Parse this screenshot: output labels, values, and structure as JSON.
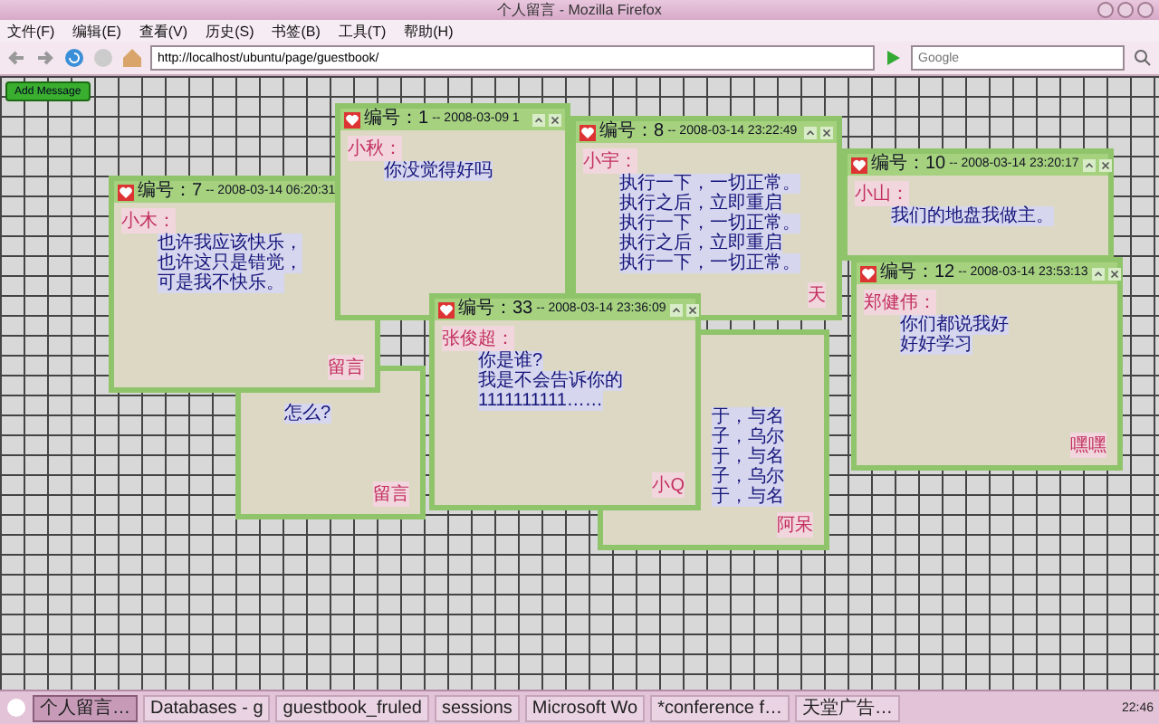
{
  "window": {
    "title": "个人留言 - Mozilla Firefox"
  },
  "menu": [
    "文件(F)",
    "编辑(E)",
    "查看(V)",
    "历史(S)",
    "书签(B)",
    "工具(T)",
    "帮助(H)"
  ],
  "address": {
    "value": "http://localhost/ubuntu/page/guestbook/"
  },
  "search": {
    "placeholder": "Google"
  },
  "add_button": "Add Message",
  "notes": [
    {
      "body": [
        "怎么?"
      ],
      "signature": "留言"
    },
    {
      "body": [
        "于，与名",
        "子，乌尔",
        "于，与名",
        "子，乌尔",
        "于，与名"
      ],
      "signature": "阿呆"
    },
    {
      "number": "编号：7",
      "date": "-- 2008-03-14 06:20:31",
      "name": "小木：",
      "body": [
        "也许我应该快乐，",
        "也许这只是错觉，",
        "可是我不快乐。"
      ],
      "signature": "留言"
    },
    {
      "number": "编号：1",
      "date": "-- 2008-03-09 1",
      "name": "小秋：",
      "body": [
        "你没觉得好吗"
      ]
    },
    {
      "number": "编号：10",
      "date": "-- 2008-03-14 23:20:17",
      "name": "小山：",
      "body": [
        "我们的地盘我做主。"
      ]
    },
    {
      "number": "编号：8",
      "date": "-- 2008-03-14 23:22:49",
      "name": "小宇：",
      "body": [
        "执行一下，一切正常。",
        "执行之后，立即重启",
        "执行一下，一切正常。",
        "执行之后，立即重启",
        "执行一下，一切正常。"
      ],
      "signature": "天"
    },
    {
      "number": "编号：33",
      "date": "-- 2008-03-14 23:36:09",
      "name": "张俊超：",
      "body": [
        "你是谁?",
        "我是不会告诉你的",
        "1111111111……"
      ],
      "signature": "小Q"
    },
    {
      "number": "编号：12",
      "date": "-- 2008-03-14 23:53:13",
      "name": "郑健伟：",
      "body": [
        "你们都说我好",
        "好好学习"
      ],
      "signature": "嘿嘿"
    }
  ],
  "taskbar": {
    "items": [
      {
        "label": "个人留言…",
        "selected": true
      },
      {
        "label": "Databases - g",
        "selected": false
      },
      {
        "label": "guestbook_fruled",
        "selected": false
      },
      {
        "label": "sessions",
        "selected": false
      },
      {
        "label": "Microsoft Wo",
        "selected": false
      },
      {
        "label": "*conference f…",
        "selected": false
      },
      {
        "label": "天堂广告…",
        "selected": false
      }
    ],
    "clock": "22:46"
  }
}
